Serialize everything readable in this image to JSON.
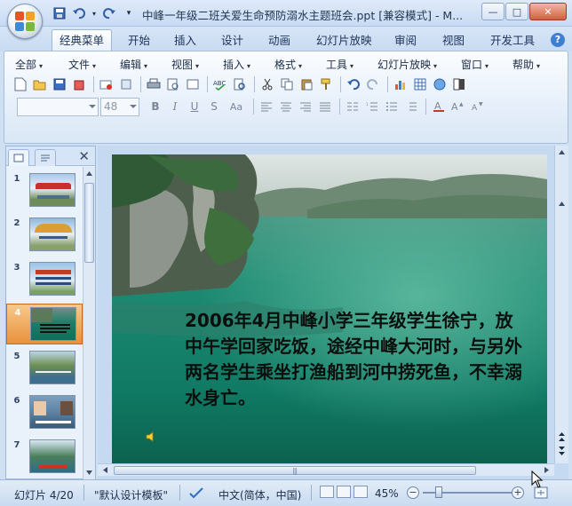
{
  "window": {
    "title": "中峰一年级二班关爱生命预防溺水主题班会.ppt [兼容模式] - M..."
  },
  "title_controls": {
    "minimize": "—",
    "maximize": "□",
    "close": "✕"
  },
  "tabs": [
    {
      "label": "经典菜单",
      "active": true
    },
    {
      "label": "开始"
    },
    {
      "label": "插入"
    },
    {
      "label": "设计"
    },
    {
      "label": "动画"
    },
    {
      "label": "幻灯片放映"
    },
    {
      "label": "审阅"
    },
    {
      "label": "视图"
    },
    {
      "label": "开发工具"
    }
  ],
  "menus": [
    "全部",
    "文件",
    "编辑",
    "视图",
    "插入",
    "格式",
    "工具",
    "幻灯片放映",
    "窗口",
    "帮助"
  ],
  "font": {
    "family_value": "",
    "size_value": "48"
  },
  "format_buttons": {
    "bold": "B",
    "italic": "I",
    "underline": "U",
    "strike": "S",
    "case": "Aa"
  },
  "slides": [
    {
      "number": "1"
    },
    {
      "number": "2"
    },
    {
      "number": "3"
    },
    {
      "number": "4",
      "active": true
    },
    {
      "number": "5"
    },
    {
      "number": "6"
    },
    {
      "number": "7"
    }
  ],
  "slide_content": {
    "text": "2006年4月中峰小学三年级学生徐宁，放中午学回家吃饭，途经中峰大河时，与另外两名学生乘坐打渔船到河中捞死鱼，不幸溺水身亡。"
  },
  "status": {
    "slide_indicator": "幻灯片 4/20",
    "theme": "\"默认设计模板\"",
    "language": "中文(简体，中国)",
    "zoom": "45%",
    "zoom_level_percent": 45
  },
  "colors": {
    "ribbon": "#dae7f6",
    "active_thumb": "#e9913b",
    "slide_water": "#14846f"
  }
}
